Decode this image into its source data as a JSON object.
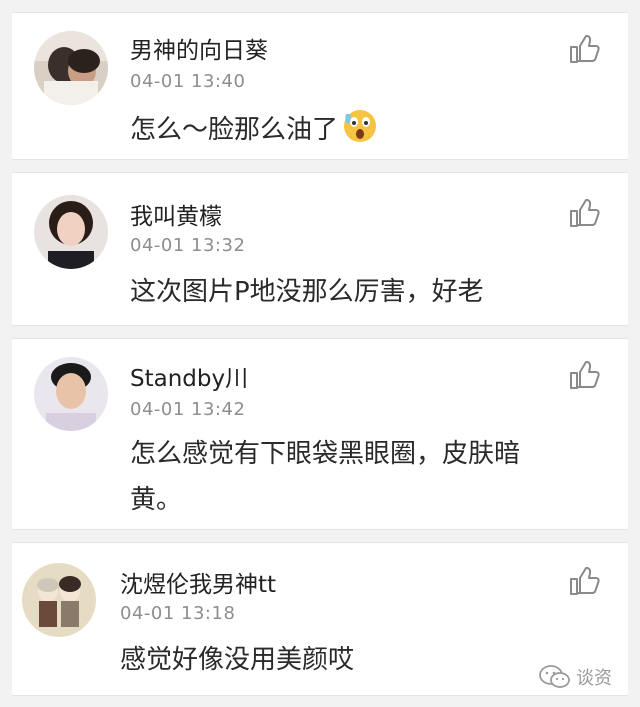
{
  "comments": [
    {
      "username": "男神的向日葵",
      "timestamp": "04-01 13:40",
      "text": "怎么～脸那么油了",
      "emoji": "shocked-face-emoji",
      "avatar": "avatar-photo"
    },
    {
      "username": "我叫黄檬",
      "timestamp": "04-01 13:32",
      "text": "这次图片P地没那么厉害，好老",
      "avatar": "avatar-photo"
    },
    {
      "username": "Standby川",
      "timestamp": "04-01 13:42",
      "text": "怎么感觉有下眼袋黑眼圈，皮肤暗黄。",
      "avatar": "avatar-photo"
    },
    {
      "username": "沈煜伦我男神tt",
      "timestamp": "04-01 13:18",
      "text": "感觉好像没用美颜哎",
      "avatar": "avatar-cartoon"
    }
  ],
  "like_icon": "thumbs-up-outline-icon",
  "watermark": {
    "text": "谈资",
    "icon": "wechat-icon"
  },
  "colors": {
    "username": "#222222",
    "timestamp": "#8e8e8e",
    "body_text": "#2a2a2a",
    "icon_gray": "#8a8a8a",
    "background": "#f2f2f2"
  }
}
